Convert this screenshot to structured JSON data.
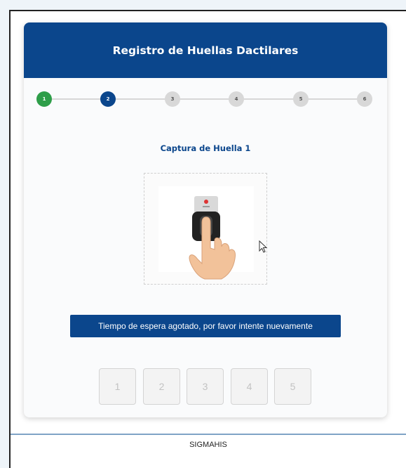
{
  "header": {
    "title": "Registro de Huellas Dactilares"
  },
  "stepper": {
    "steps": [
      {
        "label": "1",
        "state": "done"
      },
      {
        "label": "2",
        "state": "active"
      },
      {
        "label": "3",
        "state": "pending"
      },
      {
        "label": "4",
        "state": "pending"
      },
      {
        "label": "5",
        "state": "pending"
      },
      {
        "label": "6",
        "state": "pending"
      }
    ]
  },
  "capture": {
    "title": "Captura de Huella 1",
    "image_icon": "fingerprint-scanner-icon"
  },
  "status": {
    "message": "Tiempo de espera agotado, por favor intente nuevamente"
  },
  "slots": [
    {
      "label": "1"
    },
    {
      "label": "2"
    },
    {
      "label": "3"
    },
    {
      "label": "4"
    },
    {
      "label": "5"
    }
  ],
  "footer": {
    "text": "SIGMAHIS"
  },
  "colors": {
    "primary": "#0b468c",
    "success": "#2e9e49",
    "pending": "#d8d8d8"
  }
}
